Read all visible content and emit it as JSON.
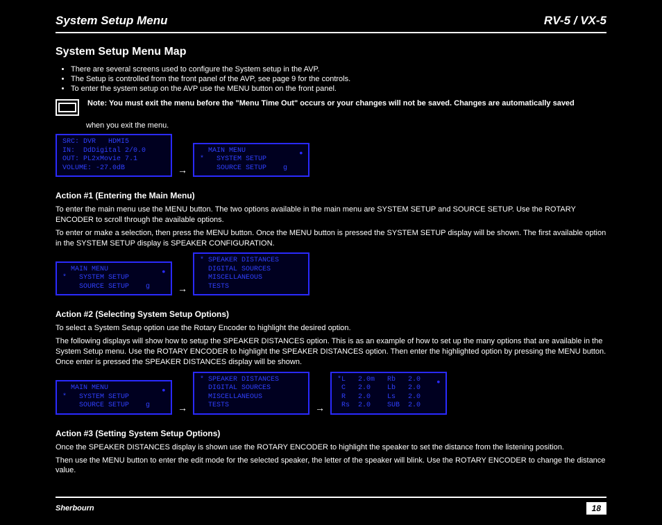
{
  "header": {
    "left": "System Setup Menu",
    "right": "RV-5 / VX-5"
  },
  "title": "System Setup Menu Map",
  "bullets": [
    "There are several screens used to configure the System setup in the AVP.",
    "The Setup is controlled from the front panel of the AVP, see page 9 for the controls.",
    "To enter the system setup on the AVP use the MENU button on the front panel."
  ],
  "note": {
    "strong_line": "You must exit the menu before the \"Menu Time Out\" occurs or your changes will not be saved. Changes are automatically saved",
    "sub_line": "when you exit the menu."
  },
  "line_group1": {
    "lcd1": {
      "l1": "SRC: DVR   HDMI5",
      "l2": "IN:  DdDigital 2/0.0",
      "l3": "OUT: PL2xMovie 7.1",
      "l4": "VOLUME: -27.0dB"
    },
    "lcd2": {
      "l1": "  MAIN MENU",
      "l2": "*   SYSTEM SETUP",
      "l3": "    SOURCE SETUP    g"
    }
  },
  "step1": {
    "heading": "Action #1 (Entering the Main Menu)",
    "p1": "To enter the main menu use the MENU button. The two options available in the main menu are SYSTEM SETUP and SOURCE SETUP. Use the ROTARY ENCODER to scroll through the available options.",
    "p2": "To enter or make a selection, then press the MENU button. Once the MENU button is pressed the SYSTEM SETUP display will be shown. The first available option in the SYSTEM SETUP display is SPEAKER CONFIGURATION."
  },
  "line_group2": {
    "lcd1": {
      "l1": "  MAIN MENU",
      "l2": "*   SYSTEM SETUP",
      "l3": "    SOURCE SETUP    g"
    },
    "lcd2": {
      "l1": "* SPEAKER DISTANCES",
      "l2": "  DIGITAL SOURCES",
      "l3": "  MISCELLANEOUS",
      "l4": "  TESTS"
    }
  },
  "step2": {
    "heading": "Action #2 (Selecting System Setup Options)",
    "p1": "To select a System Setup option use the Rotary Encoder to highlight the desired option.",
    "p2": "The following displays will show how to setup the SPEAKER DISTANCES option. This is as an example of how to set up the many options that are available in the System Setup menu. Use the ROTARY ENCODER to highlight the SPEAKER DISTANCES option. Then enter the highlighted option by pressing the MENU button. Once enter is pressed the SPEAKER DISTANCES display will be shown."
  },
  "line_group3": {
    "lcd1": {
      "l1": "  MAIN MENU",
      "l2": "*   SYSTEM SETUP",
      "l3": "    SOURCE SETUP    g"
    },
    "lcd2": {
      "l1": "* SPEAKER DISTANCES",
      "l2": "  DIGITAL SOURCES",
      "l3": "  MISCELLANEOUS",
      "l4": "  TESTS"
    },
    "lcd3": {
      "colA": {
        "l1": "*L   2.0m",
        "l2": " C   2.0",
        "l3": " R   2.0",
        "l4": " Rs  2.0"
      },
      "colB": {
        "l1": "Rb   2.0",
        "l2": "Lb   2.0",
        "l3": "Ls   2.0",
        "l4": "SUB  2.0"
      }
    }
  },
  "step3": {
    "heading": "Action #3 (Setting System Setup Options)",
    "p1": "Once the SPEAKER DISTANCES display is shown use the ROTARY ENCODER to highlight the speaker to set the distance from the listening position.",
    "p2": "Then use the MENU button to enter the edit mode for the selected speaker, the letter of the speaker will blink. Use the ROTARY ENCODER to change the distance value."
  },
  "footer": {
    "left": "Sherbourn",
    "page": "18"
  },
  "arrow": "→"
}
